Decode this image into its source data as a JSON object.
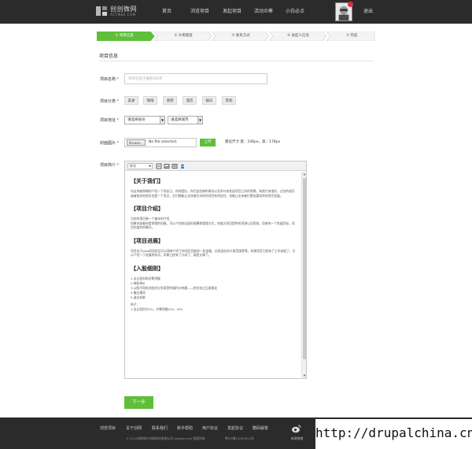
{
  "header": {
    "logo_name": "创创微网",
    "logo_sub": "ACTWEE.COM",
    "nav": [
      "首页",
      "浏览项目",
      "发起项目",
      "活动众筹",
      "小白必点"
    ],
    "logout": "退出"
  },
  "steps": [
    "① 项目信息",
    "② 众筹额度",
    "③ 联系方式",
    "④ 发起人信息",
    "⑤ 完成"
  ],
  "form": {
    "section_title": "项目信息",
    "name_label": "项目名称",
    "name_placeholder": "项目名限于截图日8字",
    "category_label": "项目分类",
    "categories": [
      "美食",
      "咖啡",
      "酒吧",
      "酒店",
      "娱乐",
      "其他"
    ],
    "address_label": "项目地址",
    "province_select": "请选择省份",
    "city_select": "请选择城市",
    "cover_label": "封面图片",
    "file_button": "Browse...",
    "file_status": "No file selected.",
    "upload_button": "上传",
    "size_hint": "建议尺寸 宽：336px，高：178px",
    "intro_label": "项目简介",
    "required_mark": "*"
  },
  "editor": {
    "format_select": "样式",
    "tools": [
      "bold-icon",
      "image-icon",
      "table-icon",
      "person-icon"
    ],
    "sections": [
      {
        "heading": "【关于我们】",
        "body": "向支持者简略的介绍一下你自己。你的团队，你们这些做的情况以及你与你发起项目之间的背景。有照片来很好，过往的经历或者相关的经历也是一个亮点，它们都能让支持者们对你的项目有所信任，也能让支持者们更加喜欢你的项目发展。"
      },
      {
        "heading": "【项目介绍】",
        "body": "为你的项目做一个基本的介绍\n如果你拿着的是餐馆的创意，可以介绍你店面的规模和管理方式，你能为项目提供的资源以及帮助，用来的一个发展目标，项目的盈利的模式。"
      },
      {
        "heading": "【项目进展】",
        "body": "项目处于idea阶段的话可以简单介绍下你项目目前的一些准备，比如选址的大致范围等等。如果项目已经有了工作流程了，可以介绍一下进展的状况。如果已经有了分成了，真是太棒了。"
      },
      {
        "heading": "【入股细则】",
        "items": [
          "1.出让股份和总筹资额",
          "2.每股单价",
          "3.认购不同档次股份分别享受的福利与待遇——经交流之后再细化",
          "4.集注事项",
          "5.退出机制"
        ],
        "example_title": "例子：",
        "example_item": "1.出让股份为5%，共筹资额100，000"
      }
    ]
  },
  "next_button": "下一步",
  "footer": {
    "links": [
      "浏览项目",
      "关于创网",
      "联系我们",
      "新手帮助",
      "用户协议",
      "发起协议",
      "酷码解答"
    ],
    "copyright": "© 2014创新微众创网科技有限公司 actwee.com 版权所有",
    "icp": "粤ICP备14093024号",
    "weibo_label": "新浪微博"
  },
  "watermark": "http://drupalchina.cn",
  "colors": {
    "accent": "#5fbf3b",
    "header_bg": "#2b2b2b",
    "notice": "#e0313b"
  }
}
